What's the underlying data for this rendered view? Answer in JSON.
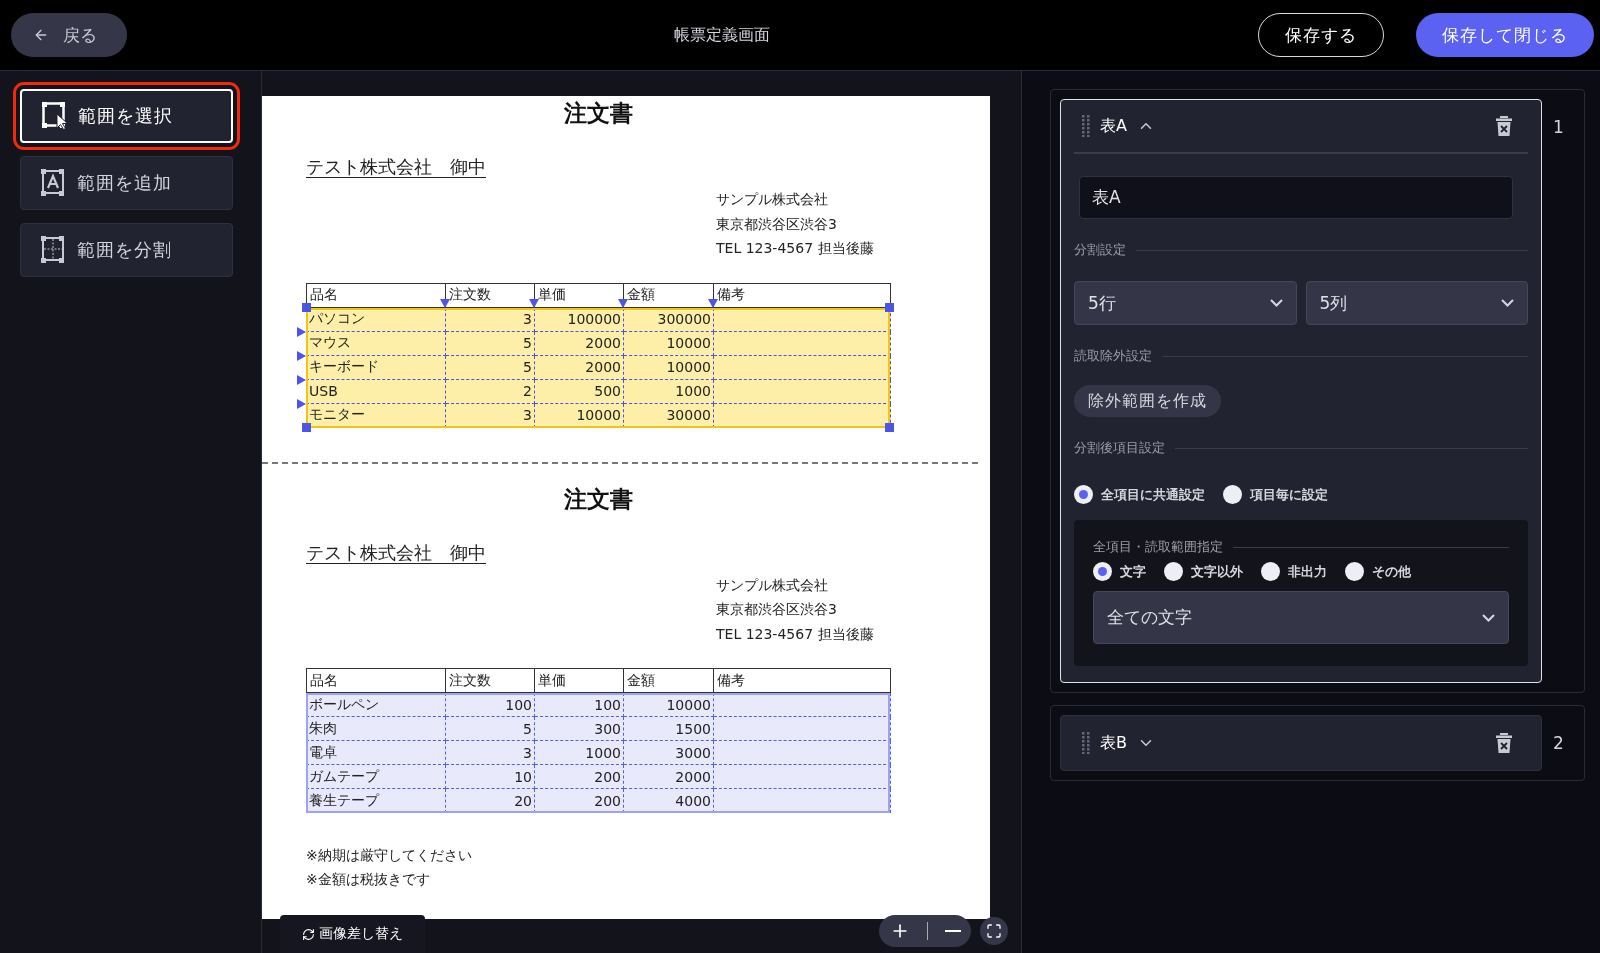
{
  "header": {
    "back_label": "戻る",
    "title": "帳票定義画面",
    "buttons": [
      {
        "label": "保存する",
        "kind": "outline"
      },
      {
        "label": "保存して閉じる",
        "kind": "primary"
      }
    ]
  },
  "tools": [
    {
      "label": "範囲を選択",
      "kind": "select",
      "selected": true
    },
    {
      "label": "範囲を追加",
      "kind": "add",
      "selected": false
    },
    {
      "label": "範囲を分割",
      "kind": "split",
      "selected": false
    }
  ],
  "document": {
    "forms": [
      {
        "title": "注文書",
        "addressee": "テスト株式会社　御中",
        "sender_lines": [
          "サンプル株式会社",
          "東京都渋谷区渋谷3",
          "TEL 123-4567 担当後藤"
        ],
        "table": {
          "selected": true,
          "columns": [
            "品名",
            "注文数",
            "単価",
            "金額",
            "備考"
          ],
          "rows": [
            [
              "パソコン",
              "3",
              "100000",
              "300000",
              ""
            ],
            [
              "マウス",
              "5",
              "2000",
              "10000",
              ""
            ],
            [
              "キーボード",
              "5",
              "2000",
              "10000",
              ""
            ],
            [
              "USB",
              "2",
              "500",
              "1000",
              ""
            ],
            [
              "モニター",
              "3",
              "10000",
              "30000",
              ""
            ]
          ]
        }
      },
      {
        "title": "注文書",
        "addressee": "テスト株式会社　御中",
        "sender_lines": [
          "サンプル株式会社",
          "東京都渋谷区渋谷3",
          "TEL 123-4567 担当後藤"
        ],
        "table": {
          "selected": false,
          "columns": [
            "品名",
            "注文数",
            "単価",
            "金額",
            "備考"
          ],
          "rows": [
            [
              "ボールペン",
              "100",
              "100",
              "10000",
              ""
            ],
            [
              "朱肉",
              "5",
              "300",
              "1500",
              ""
            ],
            [
              "電卓",
              "3",
              "1000",
              "3000",
              ""
            ],
            [
              "ガムテープ",
              "10",
              "200",
              "2000",
              ""
            ],
            [
              "養生テープ",
              "20",
              "200",
              "4000",
              ""
            ]
          ]
        },
        "notes": [
          "※納期は厳守してください",
          "※金額は税抜きです"
        ]
      }
    ],
    "replace_image_label": "画像差し替え"
  },
  "panel": {
    "tables": [
      {
        "title": "表A",
        "number": "1",
        "expanded": true,
        "name_value": "表A",
        "split_label": "分割設定",
        "rows_select": "5行",
        "cols_select": "5列",
        "exclude_label": "読取除外設定",
        "exclude_button": "除外範囲を作成",
        "item_label": "分割後項目設定",
        "item_modes": [
          {
            "label": "全項目に共通設定",
            "selected": true
          },
          {
            "label": "項目毎に設定",
            "selected": false
          }
        ],
        "range_title": "全項目・読取範囲指定",
        "range_types": [
          {
            "label": "文字",
            "selected": true
          },
          {
            "label": "文字以外",
            "selected": false
          },
          {
            "label": "非出力",
            "selected": false
          },
          {
            "label": "その他",
            "selected": false
          }
        ],
        "range_select": "全ての文字"
      },
      {
        "title": "表B",
        "number": "2",
        "expanded": false
      }
    ]
  }
}
